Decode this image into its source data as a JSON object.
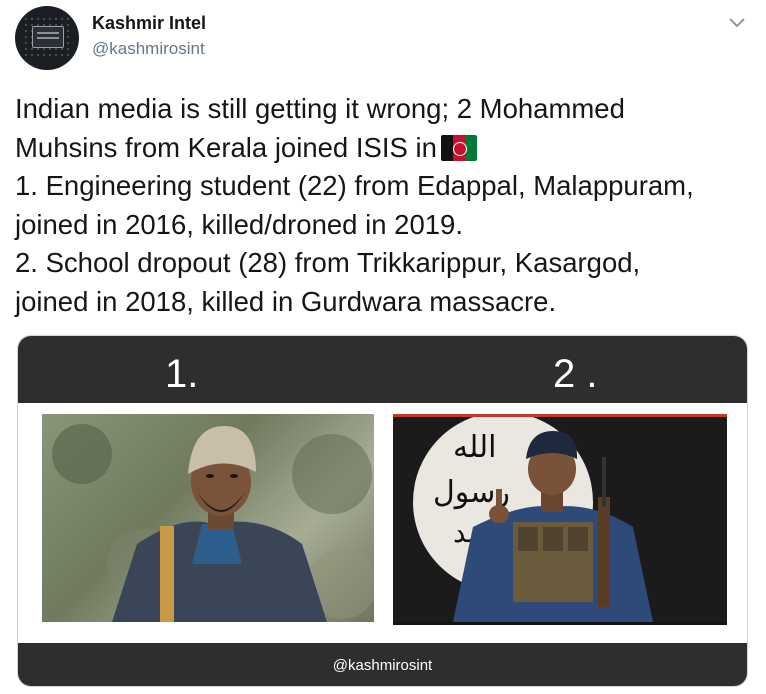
{
  "tweet": {
    "author_name": "Kashmir Intel",
    "author_handle": "@kashmirosint",
    "text": "Indian media is still getting it wrong; 2 Mohammed\nMuhsins from Kerala joined ISIS in",
    "text_lines": [
      "1. Engineering student (22) from Edappal, Malappuram,",
      "joined in 2016, killed/droned in 2019.",
      "2. School dropout (28) from Trikkarippur, Kasargod,",
      "joined in 2018, killed in Gurdwara massacre."
    ],
    "flag_icon": "afghanistan-flag-icon"
  },
  "media": {
    "label_1": "1.",
    "label_2": "2 .",
    "watermark": "@kashmirosint",
    "flag_arabic_text": "الله رسول محمد"
  }
}
